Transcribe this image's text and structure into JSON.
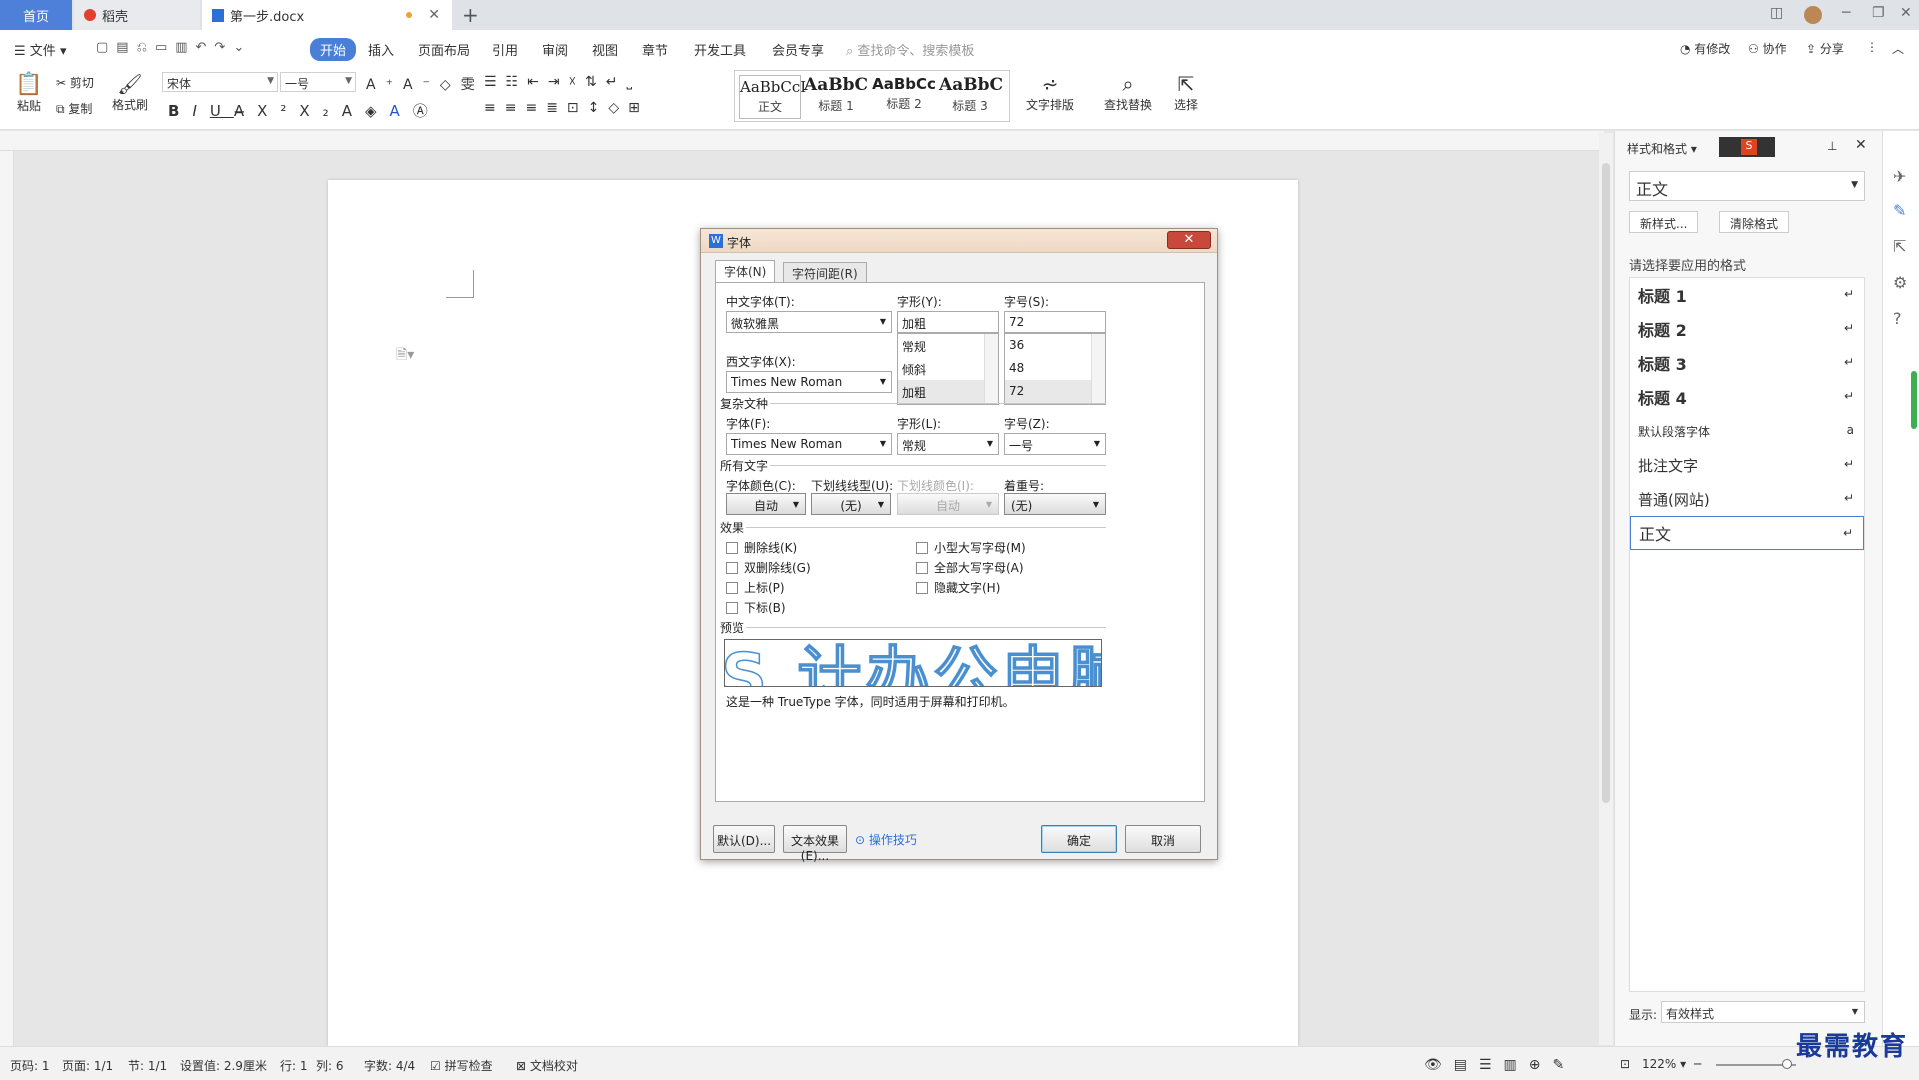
{
  "tabs": {
    "home": "首页",
    "daoke": "稻壳",
    "doc": "第一步.docx"
  },
  "menu": {
    "file": "文件",
    "start": "开始",
    "insert": "插入",
    "layout": "页面布局",
    "ref": "引用",
    "review": "审阅",
    "view": "视图",
    "chapter": "章节",
    "dev": "开发工具",
    "vip": "会员专享",
    "search_placeholder": "查找命令、搜索模板",
    "modified": "有修改",
    "collab": "协作",
    "share": "分享"
  },
  "ribbon": {
    "paste": "粘贴",
    "cut": "剪切",
    "copy": "复制",
    "format_painter": "格式刷",
    "font_name": "宋体",
    "font_size": "一号",
    "styles": [
      {
        "preview": "AaBbCcI",
        "name": "正文"
      },
      {
        "preview": "AaBbC",
        "name": "标题 1"
      },
      {
        "preview": "AaBbCc",
        "name": "标题 2"
      },
      {
        "preview": "AaBbC",
        "name": "标题 3"
      }
    ],
    "text_layout": "文字排版",
    "find_replace": "查找替换",
    "select": "选择"
  },
  "panel": {
    "title": "样式和格式",
    "current_style": "正文",
    "new_style": "新样式...",
    "clear_format": "清除格式",
    "prompt": "请选择要应用的格式",
    "items": [
      {
        "label": "标题  1",
        "mark": "↵"
      },
      {
        "label": "标题  2",
        "mark": "↵"
      },
      {
        "label": "标题  3",
        "mark": "↵"
      },
      {
        "label": "标题  4",
        "mark": "↵"
      },
      {
        "label": "默认段落字体",
        "mark": "a"
      },
      {
        "label": "批注文字",
        "mark": "↵"
      },
      {
        "label": "普通(网站)",
        "mark": "↵"
      },
      {
        "label": "正文",
        "mark": "↵"
      }
    ],
    "show_label": "显示:",
    "show_value": "有效样式"
  },
  "dialog": {
    "title": "字体",
    "tab_font": "字体(N)",
    "tab_spacing": "字符间距(R)",
    "cn_font_label": "中文字体(T):",
    "cn_font": "微软雅黑",
    "style_label": "字形(Y):",
    "style_value": "加粗",
    "size_label": "字号(S):",
    "size_value": "72",
    "style_list": [
      "常规",
      "倾斜",
      "加粗"
    ],
    "size_list": [
      "36",
      "48",
      "72"
    ],
    "west_font_label": "西文字体(X):",
    "west_font": "Times New Roman",
    "complex_section": "复杂文种",
    "complex_font_label": "字体(F):",
    "complex_font": "Times New Roman",
    "complex_style_label": "字形(L):",
    "complex_style": "常规",
    "complex_size_label": "字号(Z):",
    "complex_size": "一号",
    "all_text_section": "所有文字",
    "color_label": "字体颜色(C):",
    "color_value": "自动",
    "underline_label": "下划线线型(U):",
    "underline_value": "(无)",
    "ucolor_label": "下划线颜色(I):",
    "ucolor_value": "自动",
    "emph_label": "着重号:",
    "emph_value": "(无)",
    "effects_section": "效果",
    "strike": "删除线(K)",
    "dstrike": "双删除线(G)",
    "sup": "上标(P)",
    "sub": "下标(B)",
    "smallcaps": "小型大写字母(M)",
    "allcaps": "全部大写字母(A)",
    "hidden": "隐藏文字(H)",
    "preview_section": "预览",
    "preview_text": "S 计办公电脑",
    "preview_note": "这是一种 TrueType 字体，同时适用于屏幕和打印机。",
    "default_btn": "默认(D)...",
    "effect_btn": "文本效果(E)...",
    "tips": "操作技巧",
    "ok": "确定",
    "cancel": "取消"
  },
  "status": {
    "page_no": "页码: 1",
    "pages": "页面: 1/1",
    "section": "节: 1/1",
    "setting": "设置值: 2.9厘米",
    "line": "行: 1",
    "col": "列: 6",
    "words": "字数: 4/4",
    "spell": "拼写检查",
    "proof": "文档校对",
    "zoom": "122%"
  },
  "watermark": "最需教育",
  "colors": {
    "accent": "#4a7fd8",
    "dialog_title": "#eed8c2",
    "close_red": "#c9483c"
  }
}
